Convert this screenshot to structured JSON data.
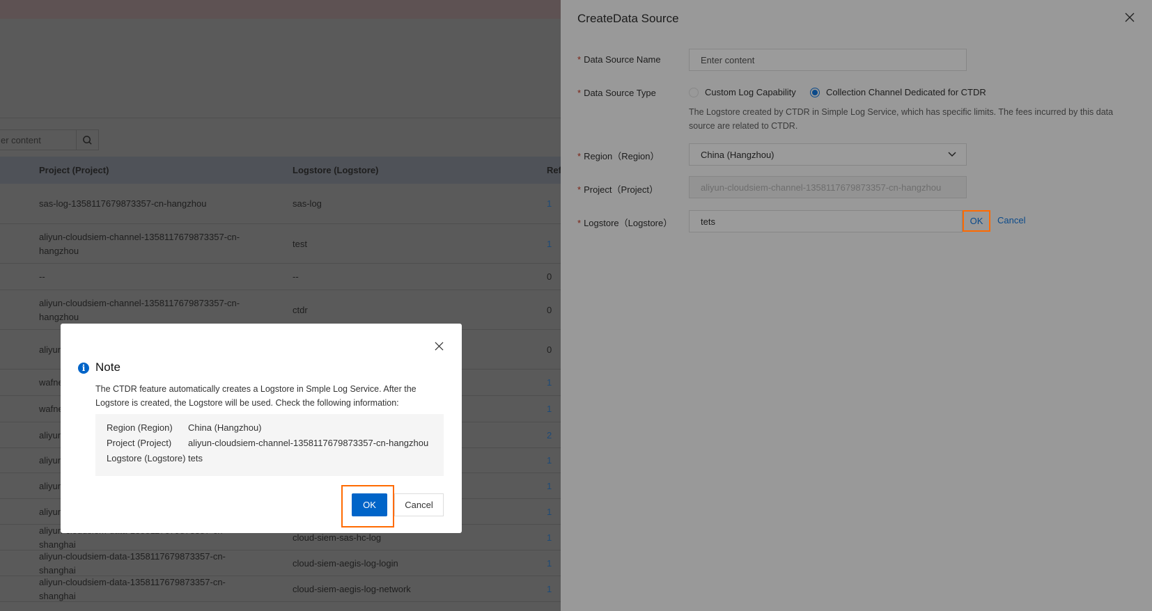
{
  "background": {
    "search_placeholder": "er content",
    "columns": [
      "Project (Project)",
      "Logstore (Logstore)",
      "Ref"
    ],
    "rows": [
      {
        "project": "sas-log-1358117679873357-cn-hangzhou",
        "logstore": "sas-log",
        "ref": "1"
      },
      {
        "project": "aliyun-cloudsiem-channel-1358117679873357-cn-hangzhou",
        "logstore": "test",
        "ref": "1"
      },
      {
        "project": "--",
        "logstore": "--",
        "ref": "0"
      },
      {
        "project": "aliyun-cloudsiem-channel-1358117679873357-cn-hangzhou",
        "logstore": "ctdr",
        "ref": "0"
      },
      {
        "project": "aliyun hangz",
        "logstore": "",
        "ref": "0"
      },
      {
        "project": "wafne",
        "logstore": "",
        "ref": "1"
      },
      {
        "project": "wafne",
        "logstore": "",
        "ref": "1"
      },
      {
        "project": "aliyun",
        "logstore": "",
        "ref": "2"
      },
      {
        "project": "aliyun",
        "logstore": "",
        "ref": "1"
      },
      {
        "project": "aliyun",
        "logstore": "",
        "ref": "1"
      },
      {
        "project": "aliyun",
        "logstore": "",
        "ref": "1"
      },
      {
        "project": "aliyun-cloudsiem-data-1358117679873357-cn-shanghai",
        "logstore": "cloud-siem-sas-hc-log",
        "ref": "1"
      },
      {
        "project": "aliyun-cloudsiem-data-1358117679873357-cn-shanghai",
        "logstore": "cloud-siem-aegis-log-login",
        "ref": "1"
      },
      {
        "project": "aliyun-cloudsiem-data-1358117679873357-cn-shanghai",
        "logstore": "cloud-siem-aegis-log-network",
        "ref": "1"
      }
    ]
  },
  "panel": {
    "title": "CreateData Source",
    "name_label": "Data Source Name",
    "name_placeholder": "Enter content",
    "type_label": "Data Source Type",
    "type_options": [
      "Custom Log Capability",
      "Collection Channel Dedicated for CTDR"
    ],
    "type_selected": "Collection Channel Dedicated for CTDR",
    "type_desc": "The Logstore created by CTDR in Simple Log Service, which has specific limits. The fees incurred by this data source are related to CTDR.",
    "region_label": "Region（Region）",
    "region_value": "China (Hangzhou)",
    "project_label": "Project（Project）",
    "project_value": "aliyun-cloudsiem-channel-1358117679873357-cn-hangzhou",
    "logstore_label": "Logstore（Logstore）",
    "logstore_value": "tets",
    "ok": "OK",
    "cancel": "Cancel"
  },
  "dialog": {
    "title": "Note",
    "message": "The CTDR feature automatically creates a Logstore in Smple Log Service. After the Logstore is created, the Logstore will be used. Check the following information:",
    "info": [
      {
        "label": "Region (Region)",
        "value": "China (Hangzhou)"
      },
      {
        "label": "Project (Project)",
        "value": "aliyun-cloudsiem-channel-1358117679873357-cn-hangzhou"
      },
      {
        "label": "Logstore (Logstore)",
        "value": "tets"
      }
    ],
    "ok": "OK",
    "cancel": "Cancel"
  },
  "colors": {
    "primary": "#0064c8",
    "highlight": "#ff6a00"
  }
}
